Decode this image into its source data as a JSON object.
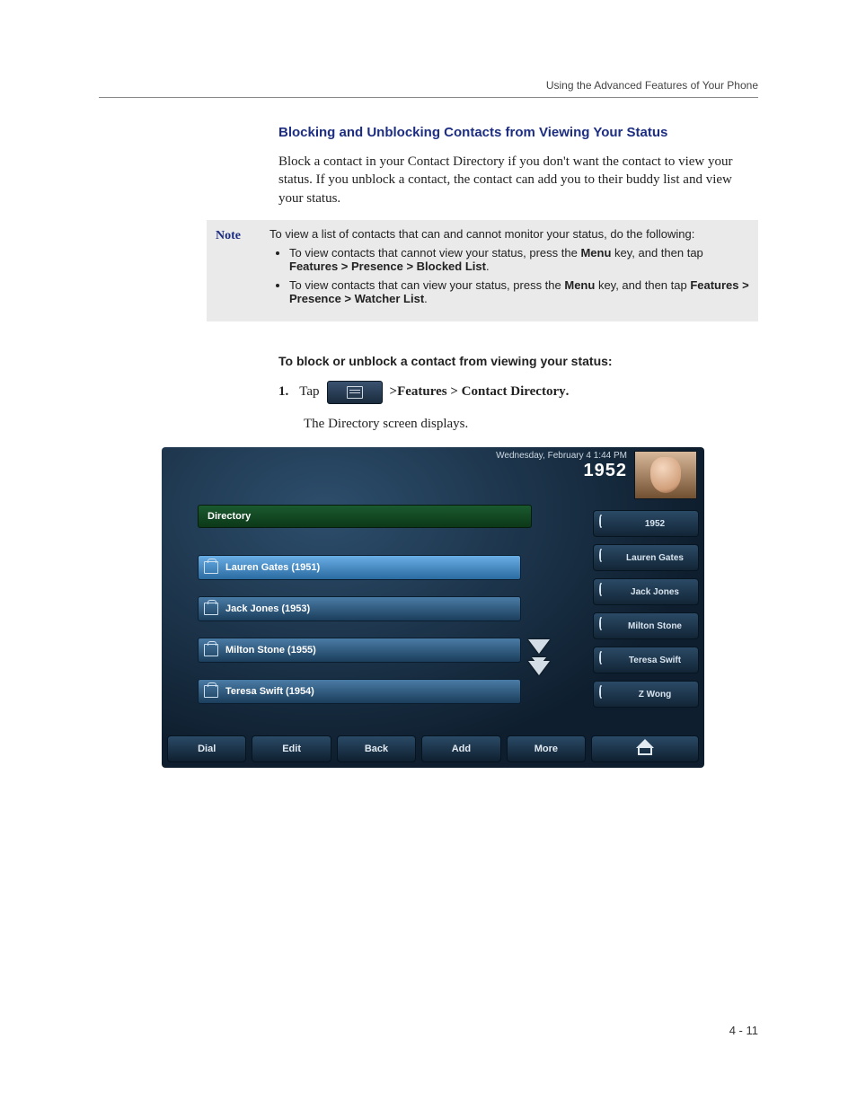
{
  "header": {
    "running": "Using the Advanced Features of Your Phone"
  },
  "section": {
    "title": "Blocking and Unblocking Contacts from Viewing Your Status",
    "intro": "Block a contact in your Contact Directory if you don't want the contact to view your status. If you unblock a contact, the contact can add you to their buddy list and view your status."
  },
  "note": {
    "label": "Note",
    "lead": "To view a list of contacts that can and cannot monitor your status, do the following:",
    "b1a": "To view contacts that cannot view your status, press the ",
    "b1menu": "Menu",
    "b1b": " key, and then tap ",
    "b1path": "Features > Presence > Blocked List",
    "b2a": "To view contacts that can view your status, press the ",
    "b2menu": "Menu",
    "b2b": " key, and then tap ",
    "b2path": "Features > Presence > Watcher List"
  },
  "procedure": {
    "heading": "To block or unblock a contact from viewing your status:",
    "step_no": "1.",
    "step_tap": "Tap",
    "step_path_prefix": "  > ",
    "step_path": "Features > Contact Directory",
    "step_result": "The Directory screen displays."
  },
  "phone": {
    "date": "Wednesday, February 4  1:44 PM",
    "extension": "1952",
    "dir_header": "Directory",
    "contacts": [
      "Lauren Gates (1951)",
      "Jack Jones (1953)",
      "Milton Stone (1955)",
      "Teresa Swift (1954)"
    ],
    "sidebar": [
      "1952",
      "Lauren Gates",
      "Jack Jones",
      "Milton Stone",
      "Teresa Swift",
      "Z Wong"
    ],
    "bottom": [
      "Dial",
      "Edit",
      "Back",
      "Add",
      "More"
    ]
  },
  "page_number": "4 - 11"
}
